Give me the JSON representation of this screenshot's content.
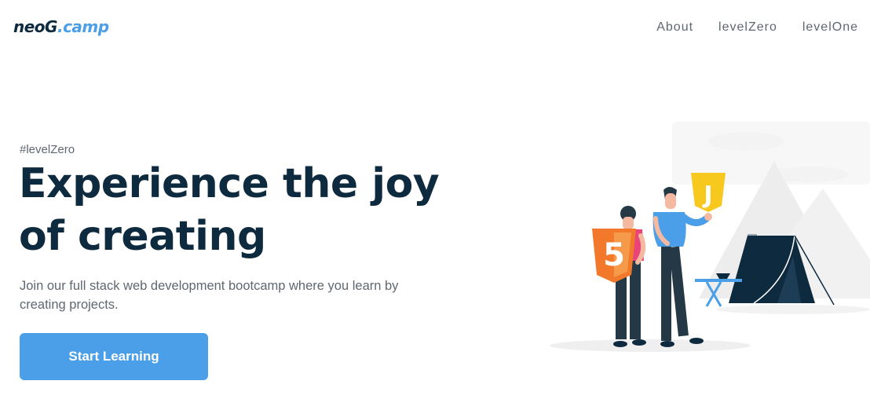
{
  "header": {
    "logo_primary": "neoG",
    "logo_secondary": ".camp",
    "nav": [
      {
        "label": "About"
      },
      {
        "label": "levelZero"
      },
      {
        "label": "levelOne"
      }
    ]
  },
  "hero": {
    "tag": "#levelZero",
    "headline_line1": "Experience the joy",
    "headline_line2": "of creating",
    "subtitle": "Join our full stack web development bootcamp where you learn by creating projects.",
    "cta_label": "Start Learning"
  },
  "illustration": {
    "html_badge_text": "5",
    "js_badge_text": "J",
    "colors": {
      "html_badge": "#f2792c",
      "js_badge": "#f7c81e",
      "tent": "#0e2a3f",
      "accent_blue": "#4a9fe8",
      "mountains": "#ededed"
    }
  },
  "colors": {
    "primary_text": "#0e2a3f",
    "muted_text": "#5f6771",
    "accent": "#4a9fe8",
    "background": "#ffffff"
  }
}
